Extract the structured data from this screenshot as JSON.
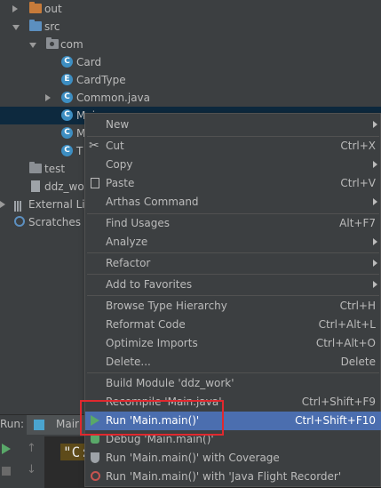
{
  "tree": {
    "items": [
      {
        "label": "out"
      },
      {
        "label": "src"
      },
      {
        "label": "com"
      },
      {
        "label": "Card",
        "badge": "C"
      },
      {
        "label": "CardType",
        "badge": "E"
      },
      {
        "label": "Common.java",
        "badge": "C"
      },
      {
        "label": "Mai",
        "badge": "C"
      },
      {
        "label": "M",
        "badge": "C"
      },
      {
        "label": "T",
        "badge": "C"
      },
      {
        "label": "test"
      },
      {
        "label": "ddz_wor"
      },
      {
        "label": "External Lib"
      },
      {
        "label": "Scratches a"
      }
    ]
  },
  "run_panel": {
    "label": "Run:",
    "tab_label": "Mair",
    "console_text": "\"C:"
  },
  "context_menu": {
    "items": [
      {
        "label": "New",
        "shortcut": ""
      },
      {
        "label": "Cut",
        "shortcut": "Ctrl+X"
      },
      {
        "label": "Copy",
        "shortcut": ""
      },
      {
        "label": "Paste",
        "shortcut": "Ctrl+V"
      },
      {
        "label": "Arthas Command",
        "shortcut": ""
      },
      {
        "label": "Find Usages",
        "shortcut": "Alt+F7"
      },
      {
        "label": "Analyze",
        "shortcut": ""
      },
      {
        "label": "Refactor",
        "shortcut": ""
      },
      {
        "label": "Add to Favorites",
        "shortcut": ""
      },
      {
        "label": "Browse Type Hierarchy",
        "shortcut": "Ctrl+H"
      },
      {
        "label": "Reformat Code",
        "shortcut": "Ctrl+Alt+L"
      },
      {
        "label": "Optimize Imports",
        "shortcut": "Ctrl+Alt+O"
      },
      {
        "label": "Delete...",
        "shortcut": "Delete"
      },
      {
        "label": "Build Module 'ddz_work'",
        "shortcut": ""
      },
      {
        "label": "Recompile 'Main.java'",
        "shortcut": "Ctrl+Shift+F9"
      },
      {
        "label": "Run 'Main.main()'",
        "shortcut": "Ctrl+Shift+F10"
      },
      {
        "label": "Debug 'Main.main()'",
        "shortcut": ""
      },
      {
        "label": "Run 'Main.main()' with Coverage",
        "shortcut": ""
      },
      {
        "label": "Run 'Main.main()' with 'Java Flight Recorder'",
        "shortcut": ""
      }
    ]
  },
  "colors": {
    "background": "#3c3f41",
    "menu_highlight": "#4b6eaf",
    "annotation_box": "#e0282e",
    "run_green": "#59a869"
  }
}
